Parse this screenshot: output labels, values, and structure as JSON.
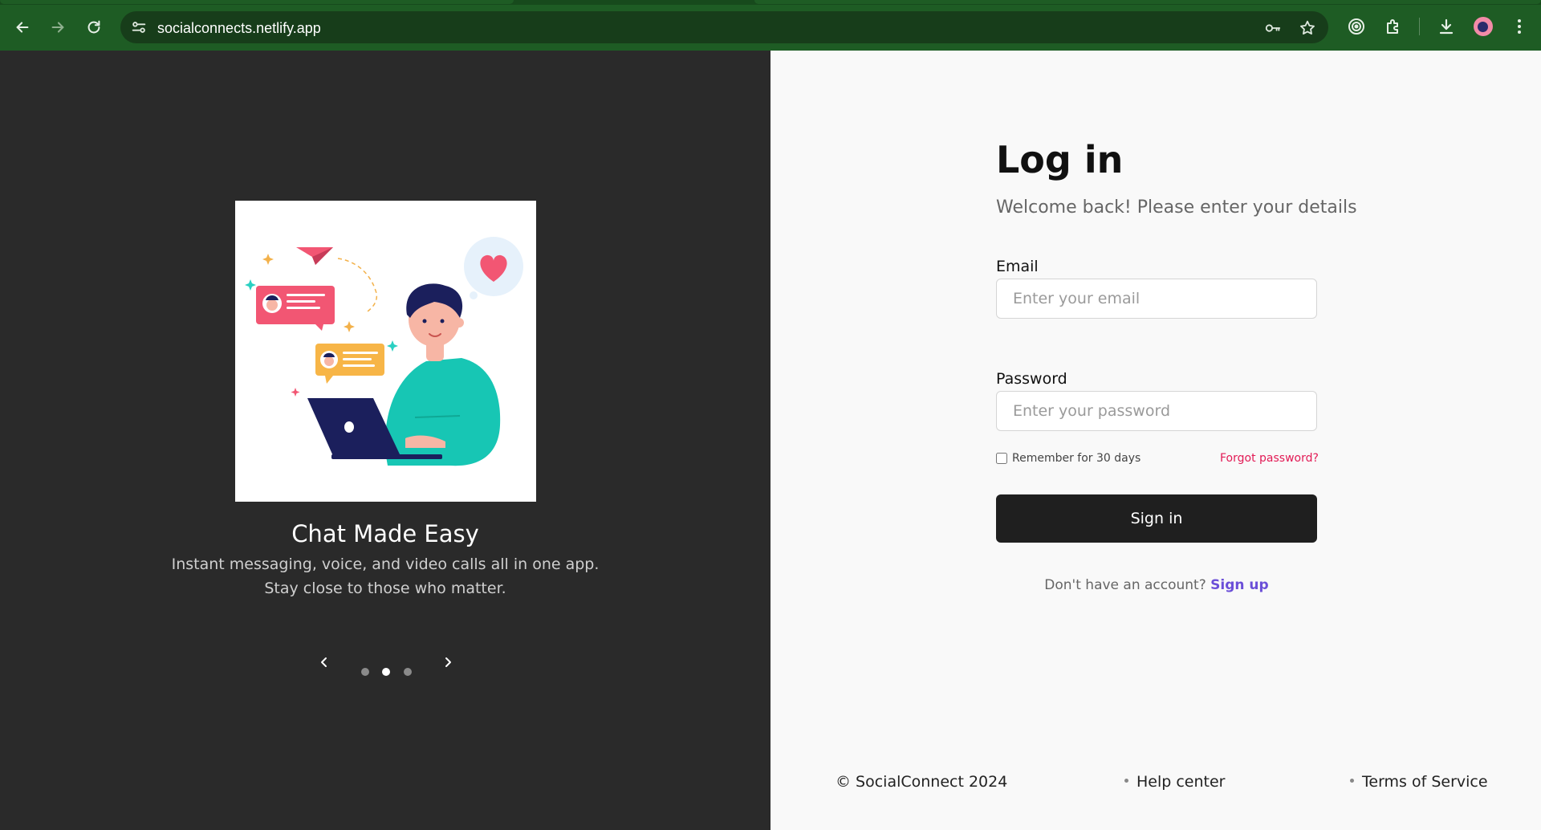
{
  "browser": {
    "url": "socialconnects.netlify.app",
    "icons": [
      "back-arrow-icon",
      "forward-arrow-icon",
      "reload-icon",
      "site-settings-icon",
      "password-key-icon",
      "bookmark-star-icon",
      "media-icon",
      "extensions-icon",
      "download-icon",
      "profile-avatar",
      "menu-dots-icon"
    ]
  },
  "carousel": {
    "title": "Chat Made Easy",
    "description_line1": "Instant messaging, voice, and video calls all in one app.",
    "description_line2": "Stay close to those who matter.",
    "slide_count": 3,
    "active_index": 1
  },
  "login": {
    "title": "Log in",
    "subtitle": "Welcome back! Please enter your details",
    "email_label": "Email",
    "email_placeholder": "Enter your email",
    "password_label": "Password",
    "password_placeholder": "Enter your password",
    "remember_label": "Remember for 30 days",
    "forgot_label": "Forgot password?",
    "signin_label": "Sign in",
    "no_account_text": "Don't have an account?",
    "signup_label": "Sign up"
  },
  "footer": {
    "copyright": "© SocialConnect 2024",
    "help": "Help center",
    "terms": "Terms of Service"
  },
  "colors": {
    "chrome_green": "#1e5c24",
    "left_bg": "#2a2a2a",
    "right_bg": "#f9f9f9",
    "button_dark": "#1f1f1f",
    "forgot_red": "#e21a55",
    "signup_purple": "#6b4fd8"
  }
}
